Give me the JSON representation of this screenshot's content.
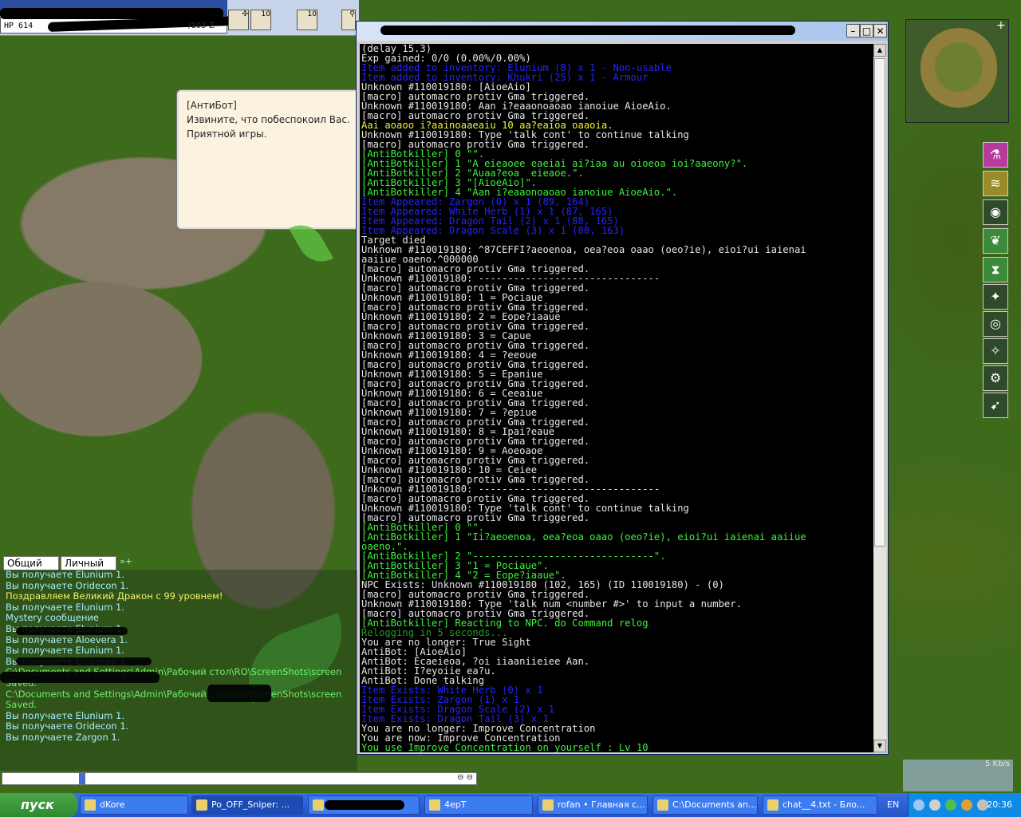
{
  "game": {
    "hp_text": "HP 614",
    "coords": "/103-Z",
    "skill_counts": [
      "10",
      "10"
    ]
  },
  "npc_dialog": {
    "lines": [
      "[АнтиБот]",
      "Извините, что побеспокоил Вас.",
      "Приятной игры."
    ]
  },
  "console": {
    "lines": [
      {
        "c": "c-w",
        "t": "(delay 15.3)"
      },
      {
        "c": "c-w",
        "t": "Exp gained: 0/0 (0.00%/0.00%)"
      },
      {
        "c": "c-b",
        "t": "Item added to inventory: Elunium (8) x 1 - Non-usable"
      },
      {
        "c": "c-b",
        "t": "Item added to inventory: Khukri (25) x 1 - Armour"
      },
      {
        "c": "c-w",
        "t": "Unknown #110019180: [AioeAio]"
      },
      {
        "c": "c-w",
        "t": "[macro] automacro protiv Gma triggered."
      },
      {
        "c": "c-w",
        "t": "Unknown #110019180: Aan i?eaaonoaoao ianoiue AioeAio."
      },
      {
        "c": "c-w",
        "t": "[macro] automacro protiv Gma triggered."
      },
      {
        "c": "c-y",
        "t": "Aai aoaoo i?aainoaaeaiu 10 aa?eaioa oaaoia."
      },
      {
        "c": "c-w",
        "t": "Unknown #110019180: Type 'talk cont' to continue talking"
      },
      {
        "c": "c-w",
        "t": "[macro] automacro protiv Gma triggered."
      },
      {
        "c": "c-g",
        "t": "[AntiBotkiller] 0 \"\"."
      },
      {
        "c": "c-g",
        "t": "[AntiBotkiller] 1 \"A eieaoee eaeiai ai?iaa au oioeoa ioi?aaeony?\"."
      },
      {
        "c": "c-g",
        "t": "[AntiBotkiller] 2 \"Auaa?eoa  eieaoe.\"."
      },
      {
        "c": "c-g",
        "t": "[AntiBotkiller] 3 \"[AioeAio]\"."
      },
      {
        "c": "c-g",
        "t": "[AntiBotkiller] 4 \"Aan i?eaaonoaoao ianoiue AioeAio.\"."
      },
      {
        "c": "c-b",
        "t": "Item Appeared: Zargon (0) x 1 (89, 164)"
      },
      {
        "c": "c-b",
        "t": "Item Appeared: White Herb (1) x 1 (87, 165)"
      },
      {
        "c": "c-b",
        "t": "Item Appeared: Dragon Tail (2) x 1 (88, 165)"
      },
      {
        "c": "c-b",
        "t": "Item Appeared: Dragon Scale (3) x 1 (88, 163)"
      },
      {
        "c": "c-w",
        "t": "Target died"
      },
      {
        "c": "c-w",
        "t": "Unknown #110019180: ^87CEFFI?aeoenoa, oea?eoa oaao (oeo?ie), eioi?ui iaienai"
      },
      {
        "c": "c-w",
        "t": "aaiiue oaeno.^000000"
      },
      {
        "c": "c-w",
        "t": "[macro] automacro protiv Gma triggered."
      },
      {
        "c": "c-w",
        "t": "Unknown #110019180: -------------------------------"
      },
      {
        "c": "c-w",
        "t": "[macro] automacro protiv Gma triggered."
      },
      {
        "c": "c-w",
        "t": "Unknown #110019180: 1 = Pociaue"
      },
      {
        "c": "c-w",
        "t": "[macro] automacro protiv Gma triggered."
      },
      {
        "c": "c-w",
        "t": "Unknown #110019180: 2 = Eope?iaaue"
      },
      {
        "c": "c-w",
        "t": "[macro] automacro protiv Gma triggered."
      },
      {
        "c": "c-w",
        "t": "Unknown #110019180: 3 = Capue"
      },
      {
        "c": "c-w",
        "t": "[macro] automacro protiv Gma triggered."
      },
      {
        "c": "c-w",
        "t": "Unknown #110019180: 4 = ?eeoue"
      },
      {
        "c": "c-w",
        "t": "[macro] automacro protiv Gma triggered."
      },
      {
        "c": "c-w",
        "t": "Unknown #110019180: 5 = Epaniue"
      },
      {
        "c": "c-w",
        "t": "[macro] automacro protiv Gma triggered."
      },
      {
        "c": "c-w",
        "t": "Unknown #110019180: 6 = Ceeaiue"
      },
      {
        "c": "c-w",
        "t": "[macro] automacro protiv Gma triggered."
      },
      {
        "c": "c-w",
        "t": "Unknown #110019180: 7 = ?epiue"
      },
      {
        "c": "c-w",
        "t": "[macro] automacro protiv Gma triggered."
      },
      {
        "c": "c-w",
        "t": "Unknown #110019180: 8 = Ipai?eaue"
      },
      {
        "c": "c-w",
        "t": "[macro] automacro protiv Gma triggered."
      },
      {
        "c": "c-w",
        "t": "Unknown #110019180: 9 = Aoeoaoe"
      },
      {
        "c": "c-w",
        "t": "[macro] automacro protiv Gma triggered."
      },
      {
        "c": "c-w",
        "t": "Unknown #110019180: 10 = Ceiee"
      },
      {
        "c": "c-w",
        "t": "[macro] automacro protiv Gma triggered."
      },
      {
        "c": "c-w",
        "t": "Unknown #110019180: -------------------------------"
      },
      {
        "c": "c-w",
        "t": "[macro] automacro protiv Gma triggered."
      },
      {
        "c": "c-w",
        "t": "Unknown #110019180: Type 'talk cont' to continue talking"
      },
      {
        "c": "c-w",
        "t": "[macro] automacro protiv Gma triggered."
      },
      {
        "c": "c-g",
        "t": "[AntiBotkiller] 0 \"\"."
      },
      {
        "c": "c-g",
        "t": "[AntiBotkiller] 1 \"Ii?aeoenoa, oea?eoa oaao (oeo?ie), eioi?ui iaienai aaiiue"
      },
      {
        "c": "c-g",
        "t": "oaeno.\"."
      },
      {
        "c": "c-g",
        "t": "[AntiBotkiller] 2 \"-------------------------------\"."
      },
      {
        "c": "c-g",
        "t": "[AntiBotkiller] 3 \"1 = Pociaue\"."
      },
      {
        "c": "c-g",
        "t": "[AntiBotkiller] 4 \"2 = Eope?iaaue\"."
      },
      {
        "c": "c-w",
        "t": "NPC Exists: Unknown #110019180 (102, 165) (ID 110019180) - (0)"
      },
      {
        "c": "c-w",
        "t": "[macro] automacro protiv Gma triggered."
      },
      {
        "c": "c-w",
        "t": "Unknown #110019180: Type 'talk num <number #>' to input a number."
      },
      {
        "c": "c-w",
        "t": "[macro] automacro protiv Gma triggered."
      },
      {
        "c": "c-g",
        "t": "[AntiBotkiller] Reacting to NPC. do Command relog"
      },
      {
        "c": "c-dg",
        "t": "Relogging in 5 seconds..."
      },
      {
        "c": "c-w",
        "t": "You are no longer: True Sight"
      },
      {
        "c": "c-w",
        "t": "AntiBot: [AioeAio]"
      },
      {
        "c": "c-w",
        "t": "AntiBot: Ecaeieoa, ?oi iiaaniieiee Aan."
      },
      {
        "c": "c-w",
        "t": "AntiBot: I?eyoiie ea?u."
      },
      {
        "c": "c-w",
        "t": "AntiBot: Done talking"
      },
      {
        "c": "c-b",
        "t": "Item Exists: White Herb (0) x 1"
      },
      {
        "c": "c-b",
        "t": "Item Exists: Zargon (1) x 1"
      },
      {
        "c": "c-b",
        "t": "Item Exists: Dragon Scale (2) x 1"
      },
      {
        "c": "c-b",
        "t": "Item Exists: Dragon Tail (3) x 1"
      },
      {
        "c": "c-w",
        "t": "You are no longer: Improve Concentration"
      },
      {
        "c": "c-w",
        "t": "You are now: Improve Concentration"
      },
      {
        "c": "c-g",
        "t": "You use Improve Concentration on yourself : Lv 10"
      }
    ]
  },
  "chat": {
    "tab_general": "Общий",
    "tab_private": "Личный",
    "lines": [
      {
        "c": "ch-c",
        "t": "Вы получаете Elunium 1."
      },
      {
        "c": "ch-c",
        "t": "Вы получаете Oridecon 1."
      },
      {
        "c": "ch-y",
        "t": "Поздравляем Великий Дракон с 99 уровнем!"
      },
      {
        "c": "ch-c",
        "t": "Вы получаете Elunium 1."
      },
      {
        "c": "ch-c",
        "t": "Mystery сообщение"
      },
      {
        "c": "ch-c",
        "t": "Вы получаете Elunium 1."
      },
      {
        "c": "ch-c",
        "t": "Вы получаете Aloevera 1."
      },
      {
        "c": "ch-c",
        "t": "Вы получаете Elunium 1."
      },
      {
        "c": "ch-c",
        "t": "Вы получаете Oridecon 1."
      },
      {
        "c": "ch-c",
        "t": ""
      },
      {
        "c": "ch-g",
        "t": "C:\\Documents and Settings\\Admin\\Рабочий стол\\RO\\ScreenShots\\screen"
      },
      {
        "c": "ch-g",
        "t": "Saved."
      },
      {
        "c": "ch-g",
        "t": "C:\\Documents and Settings\\Admin\\Рабочий стол\\RO\\ScreenShots\\screen"
      },
      {
        "c": "ch-g",
        "t": "Saved."
      },
      {
        "c": "ch-c",
        "t": "Вы получаете Elunium 1."
      },
      {
        "c": "ch-c",
        "t": "Вы получаете Oridecon 1."
      },
      {
        "c": "ch-c",
        "t": "Вы получаете Zargon 1."
      }
    ]
  },
  "net_status": {
    "speed": "5 Kb/s"
  },
  "taskbar": {
    "start_label": "пуск",
    "items": [
      {
        "label": "dKore",
        "active": false
      },
      {
        "label": "Po_OFF_Sniper: ...",
        "active": true
      },
      {
        "label": "",
        "active": false
      },
      {
        "label": "4epT",
        "active": false
      },
      {
        "label": "rofan • Главная с...",
        "active": false
      },
      {
        "label": "C:\\Documents an...",
        "active": false
      },
      {
        "label": "chat__4.txt - Бло...",
        "active": false
      }
    ],
    "lang": "EN",
    "clock": "20:36"
  },
  "colors": {
    "console_bg": "#000000",
    "console_white": "#e6e6e6",
    "console_green": "#3cf23c",
    "console_blue": "#2424ff",
    "console_yellow": "#f2f23c",
    "taskbar_blue": "#2253c7",
    "start_green": "#2f8a2f"
  }
}
